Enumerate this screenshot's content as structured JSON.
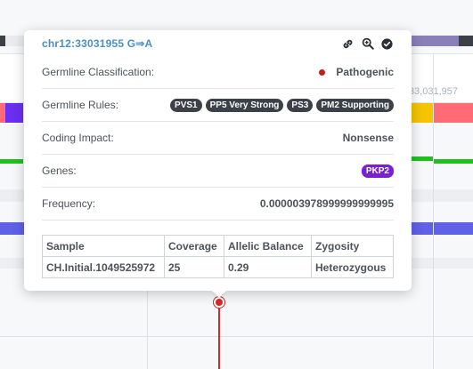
{
  "background": {
    "coordinate_label": "33,031,957",
    "colors": {
      "track_purple": "#6060e8",
      "track_orange": "#f3a630",
      "track_red": "#ff6a75",
      "track_yellow": "#f5c400",
      "track_green": "#1ec21e",
      "variant_red": "#d02a2a"
    }
  },
  "popover": {
    "title": "chr12:33031955 G⇒A",
    "icons": [
      "link-icon",
      "zoom-in-icon",
      "check-circle-icon"
    ],
    "rows": {
      "classification": {
        "label": "Germline Classification:",
        "value": "Pathogenic",
        "status_color": "#c0201d"
      },
      "rules": {
        "label": "Germline Rules:",
        "pills": [
          "PVS1",
          "PP5 Very Strong",
          "PS3",
          "PM2 Supporting"
        ]
      },
      "impact": {
        "label": "Coding Impact:",
        "value": "Nonsense"
      },
      "genes": {
        "label": "Genes:",
        "pill": "PKP2"
      },
      "frequency": {
        "label": "Frequency:",
        "value": "0.000003978999999999995"
      }
    },
    "table": {
      "headers": [
        "Sample",
        "Coverage",
        "Allelic Balance",
        "Zygosity"
      ],
      "rows": [
        [
          "CH.Initial.1049525972",
          "25",
          "0.29",
          "Heterozygous"
        ]
      ]
    }
  }
}
